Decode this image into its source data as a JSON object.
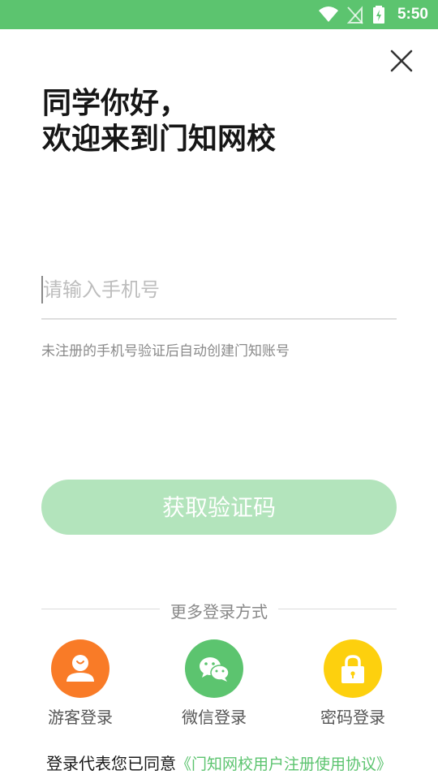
{
  "status_bar": {
    "time": "5:50",
    "background": "#5cc46f",
    "icons": [
      "wifi-icon",
      "no-signal-icon",
      "battery-charging-icon"
    ]
  },
  "header": {
    "close_icon": "close-icon"
  },
  "greeting": {
    "line1": "同学你好，",
    "line2": "欢迎来到门知网校"
  },
  "phone": {
    "placeholder": "请输入手机号",
    "value": "",
    "hint": "未注册的手机号验证后自动创建门知账号"
  },
  "actions": {
    "get_code_label": "获取验证码",
    "get_code_color": "#b3e4bc"
  },
  "more_login": {
    "title": "更多登录方式",
    "options": [
      {
        "label": "游客登录",
        "icon": "guest-user-icon",
        "color": "#f97b27"
      },
      {
        "label": "微信登录",
        "icon": "wechat-icon",
        "color": "#5cc46f"
      },
      {
        "label": "密码登录",
        "icon": "lock-icon",
        "color": "#fdd00e"
      }
    ]
  },
  "agreement": {
    "prefix": "登录代表您已同意",
    "link": "《门知网校用户注册使用协议》",
    "link_color": "#5cc46f"
  }
}
